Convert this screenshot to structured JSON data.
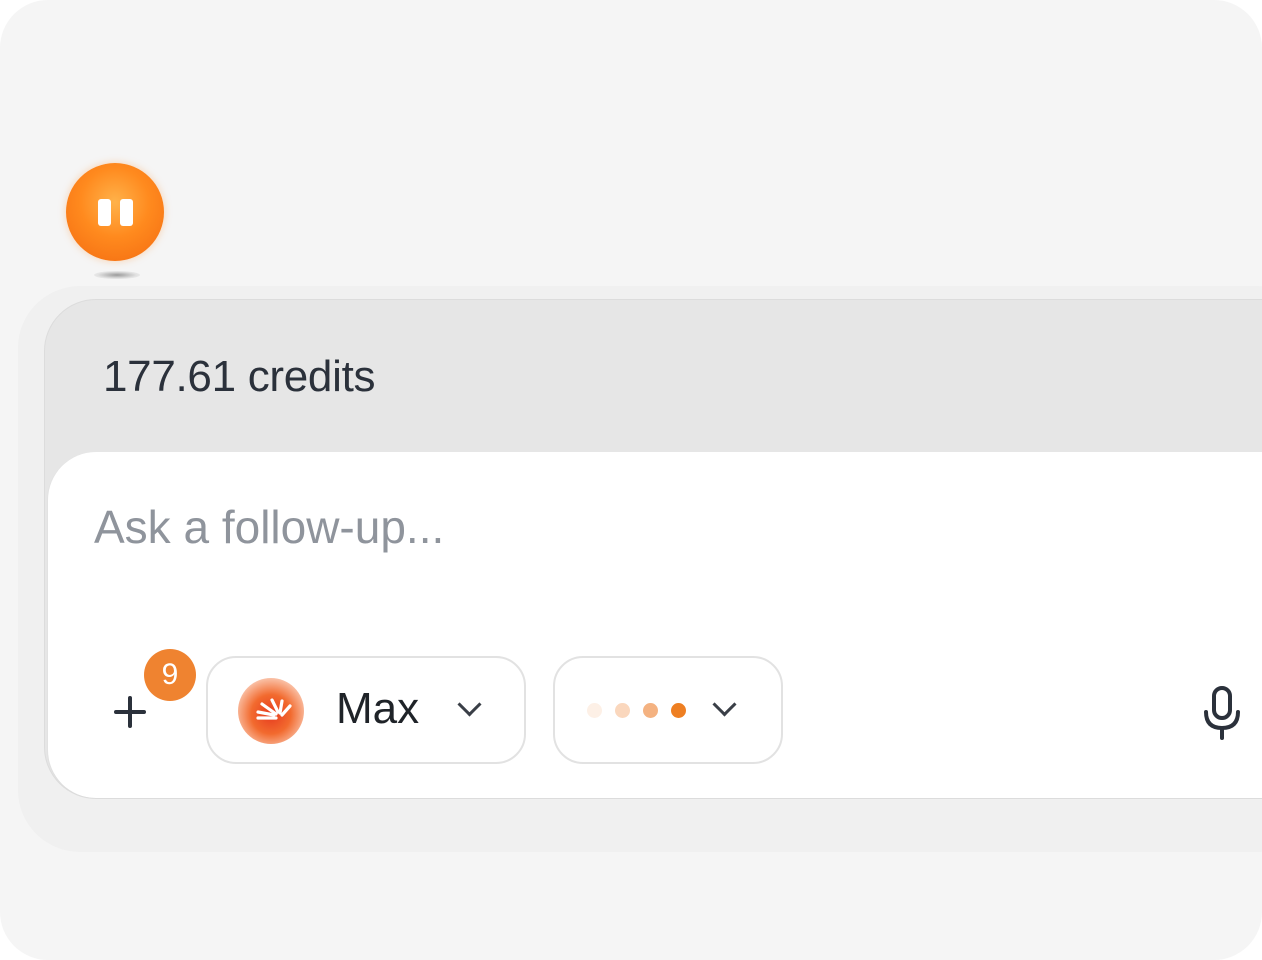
{
  "pause_button": {
    "icon": "pause-icon",
    "color": "#ff8a1e"
  },
  "composer": {
    "credits_text": "177.61 credits",
    "input": {
      "placeholder": "Ask a follow-up...",
      "value": ""
    },
    "attach": {
      "icon": "plus-icon",
      "badge_count": "9",
      "badge_color": "#ef8330"
    },
    "model_select": {
      "icon": "model-burst-icon",
      "label": "Max",
      "chevron": "chevron-down-icon"
    },
    "effort_select": {
      "dots": [
        "#fdf0e6",
        "#fad7bd",
        "#f4b281",
        "#ee7f22"
      ],
      "chevron": "chevron-down-icon"
    },
    "mic": {
      "icon": "microphone-icon"
    }
  }
}
